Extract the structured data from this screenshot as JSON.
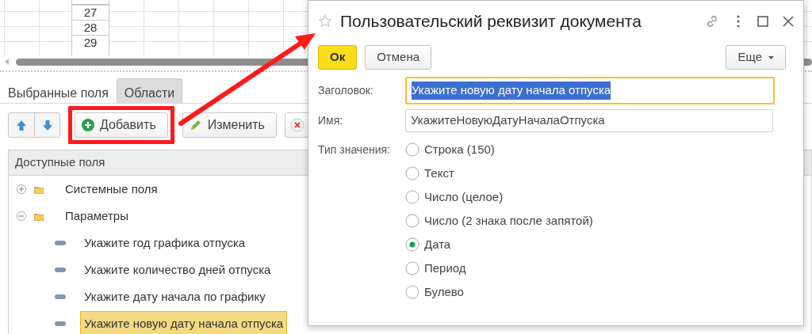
{
  "sheet": {
    "row_numbers": [
      "27",
      "28",
      "29"
    ]
  },
  "tabs": [
    {
      "label": "Выбранные поля",
      "selected": true
    },
    {
      "label": "Области",
      "selected": false
    }
  ],
  "toolbar": {
    "buttons": [
      {
        "kind": "up"
      },
      {
        "kind": "down"
      },
      {
        "kind": "add",
        "label": "Добавить",
        "highlighted": true
      },
      {
        "kind": "edit",
        "label": "Изменить",
        "highlighted": false
      },
      {
        "kind": "delete",
        "highlighted": false
      }
    ]
  },
  "tree": {
    "header": "Доступные поля",
    "items": [
      {
        "label": "Системные поля",
        "expanded": false,
        "selected": false
      },
      {
        "label": "Параметры",
        "expanded": true,
        "selected": false,
        "children": [
          {
            "label": "Укажите год графика отпуска",
            "selected": false
          },
          {
            "label": "Укажите количество дней отпуска",
            "selected": false
          },
          {
            "label": "Укажите дату начала по графику",
            "selected": false
          },
          {
            "label": "Укажите новую дату начала отпуска",
            "selected": true
          }
        ]
      }
    ]
  },
  "dialog": {
    "title": "Пользовательский реквизит документа",
    "buttons": [
      {
        "kind": "default",
        "label": "Ок"
      },
      {
        "kind": "normal",
        "label": "Отмена"
      },
      {
        "kind": "menu",
        "label": "Еще"
      }
    ],
    "fields": [
      {
        "label": "Заголовок:",
        "value": "Укажите новую дату начала отпуска",
        "focused": true,
        "text_selected": true
      },
      {
        "label": "Имя:",
        "value": "УкажитеНовуюДатуНачалаОтпуска",
        "focused": false,
        "text_selected": false
      }
    ],
    "value_type": {
      "label": "Тип значения:",
      "options": [
        {
          "label": "Строка (150)",
          "selected": false
        },
        {
          "label": "Текст",
          "selected": false
        },
        {
          "label": "Число (целое)",
          "selected": false
        },
        {
          "label": "Число (2 знака после запятой)",
          "selected": false
        },
        {
          "label": "Дата",
          "selected": true
        },
        {
          "label": "Период",
          "selected": false
        },
        {
          "label": "Булево",
          "selected": false
        }
      ]
    }
  },
  "callouts": [
    {
      "kind": "arrow"
    }
  ]
}
